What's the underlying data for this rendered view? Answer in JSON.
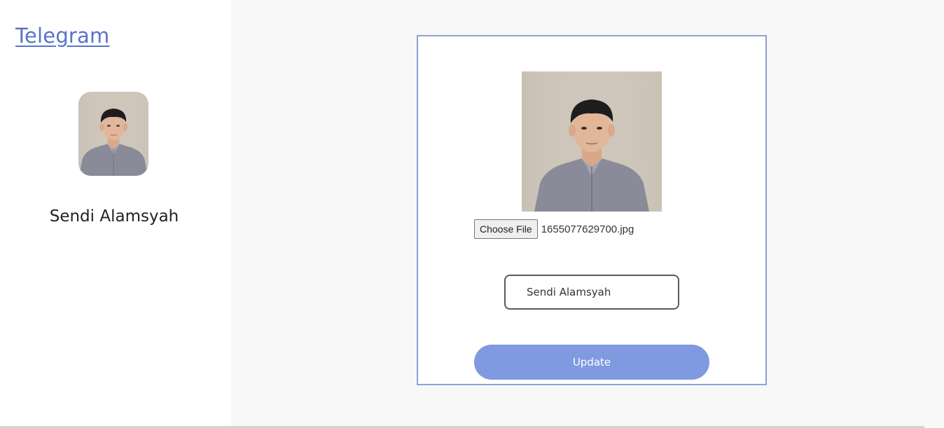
{
  "sidebar": {
    "brand": "Telegram",
    "profile_name": "Sendi Alamsyah",
    "avatar_icon": "person-photo-icon"
  },
  "edit_form": {
    "choose_file_label": "Choose File",
    "selected_file": "1655077629700.jpg",
    "name_value": "Sendi Alamsyah",
    "update_label": "Update",
    "photo_icon": "person-photo-icon"
  },
  "colors": {
    "brand_link": "#5873c9",
    "card_border": "#8ea2d4",
    "update_button": "#7f9ae0",
    "page_background": "#f8f8f8"
  }
}
